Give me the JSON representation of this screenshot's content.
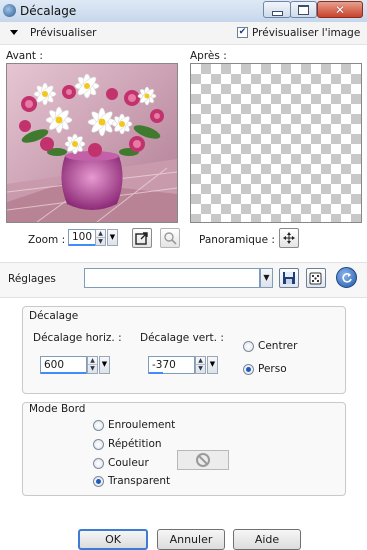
{
  "window": {
    "title": "Décalage"
  },
  "preview": {
    "header_label": "Prévisualiser",
    "checkbox_label": "Prévisualiser l'image",
    "checkbox_checked": true,
    "before_label": "Avant :",
    "after_label": "Après :"
  },
  "zoom": {
    "label": "Zoom :",
    "value": "100"
  },
  "pan": {
    "label": "Panoramique :"
  },
  "settings": {
    "label": "Réglages",
    "preset_value": ""
  },
  "offset_group": {
    "title": "Décalage",
    "horizontal_label": "Décalage horiz. :",
    "horizontal_value": "600",
    "vertical_label": "Décalage vert. :",
    "vertical_value": "-370",
    "options": [
      {
        "label": "Centrer",
        "selected": false
      },
      {
        "label": "Perso",
        "selected": true
      }
    ]
  },
  "edge_group": {
    "title": "Mode Bord",
    "options": [
      {
        "label": "Enroulement",
        "selected": false
      },
      {
        "label": "Répétition",
        "selected": false
      },
      {
        "label": "Couleur",
        "selected": false
      },
      {
        "label": "Transparent",
        "selected": true
      }
    ]
  },
  "buttons": {
    "ok": "OK",
    "cancel": "Annuler",
    "help": "Aide"
  },
  "colors": {
    "accent": "#3e8ef7",
    "title_bar": "#c6d7ec",
    "close": "#c8432c"
  }
}
